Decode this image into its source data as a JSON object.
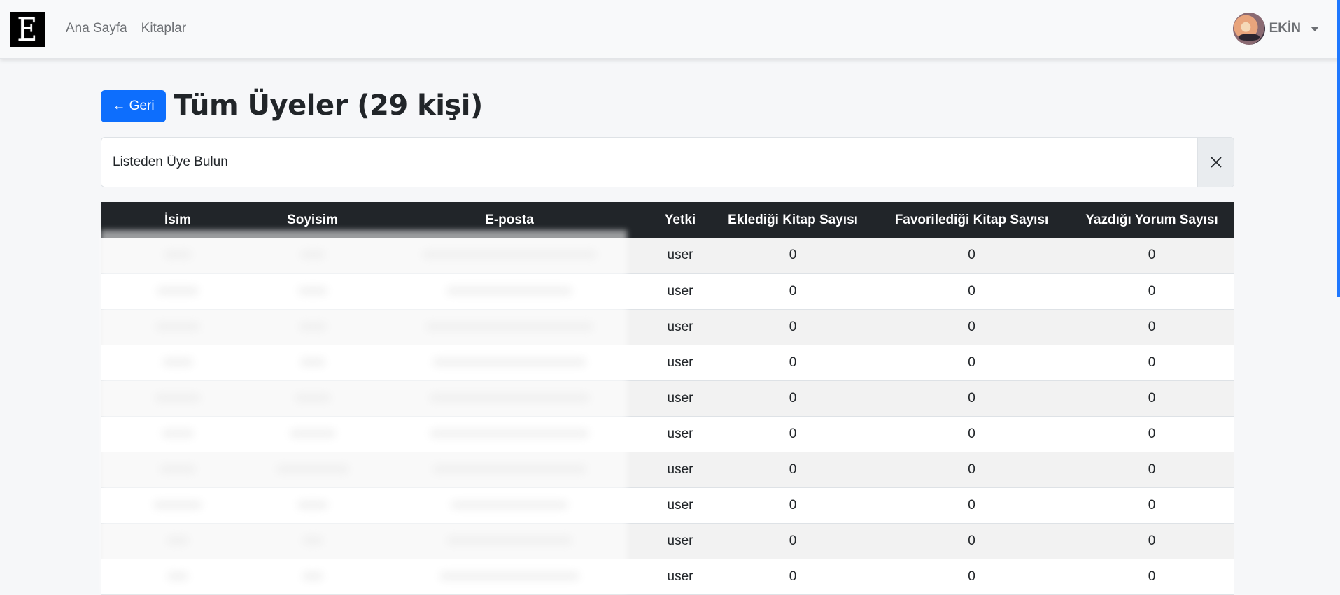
{
  "nav": {
    "brand_letter": "E",
    "links": [
      "Ana Sayfa",
      "Kitaplar"
    ],
    "user_name": "EKİN"
  },
  "header": {
    "back_label": "← Geri",
    "title": "Tüm Üyeler (29 kişi)"
  },
  "search": {
    "placeholder": "Listeden Üye Bulun"
  },
  "table": {
    "columns": [
      "İsim",
      "Soyisim",
      "E-posta",
      "Yetki",
      "Eklediği Kitap Sayısı",
      "Favorilediği Kitap Sayısı",
      "Yazdığı Yorum Sayısı"
    ],
    "rows": [
      {
        "yetki": "user",
        "eklenen": "0",
        "favori": "0",
        "yorum": "0"
      },
      {
        "yetki": "user",
        "eklenen": "0",
        "favori": "0",
        "yorum": "0"
      },
      {
        "yetki": "user",
        "eklenen": "0",
        "favori": "0",
        "yorum": "0"
      },
      {
        "yetki": "user",
        "eklenen": "0",
        "favori": "0",
        "yorum": "0"
      },
      {
        "yetki": "user",
        "eklenen": "0",
        "favori": "0",
        "yorum": "0"
      },
      {
        "yetki": "user",
        "eklenen": "0",
        "favori": "0",
        "yorum": "0"
      },
      {
        "yetki": "user",
        "eklenen": "0",
        "favori": "0",
        "yorum": "0"
      },
      {
        "yetki": "user",
        "eklenen": "0",
        "favori": "0",
        "yorum": "0"
      },
      {
        "yetki": "user",
        "eklenen": "0",
        "favori": "0",
        "yorum": "0"
      },
      {
        "yetki": "user",
        "eklenen": "0",
        "favori": "0",
        "yorum": "0"
      }
    ]
  },
  "colors": {
    "primary": "#0d6efd",
    "table_header_bg": "#212529",
    "navbar_bg": "#f8f9fa"
  }
}
